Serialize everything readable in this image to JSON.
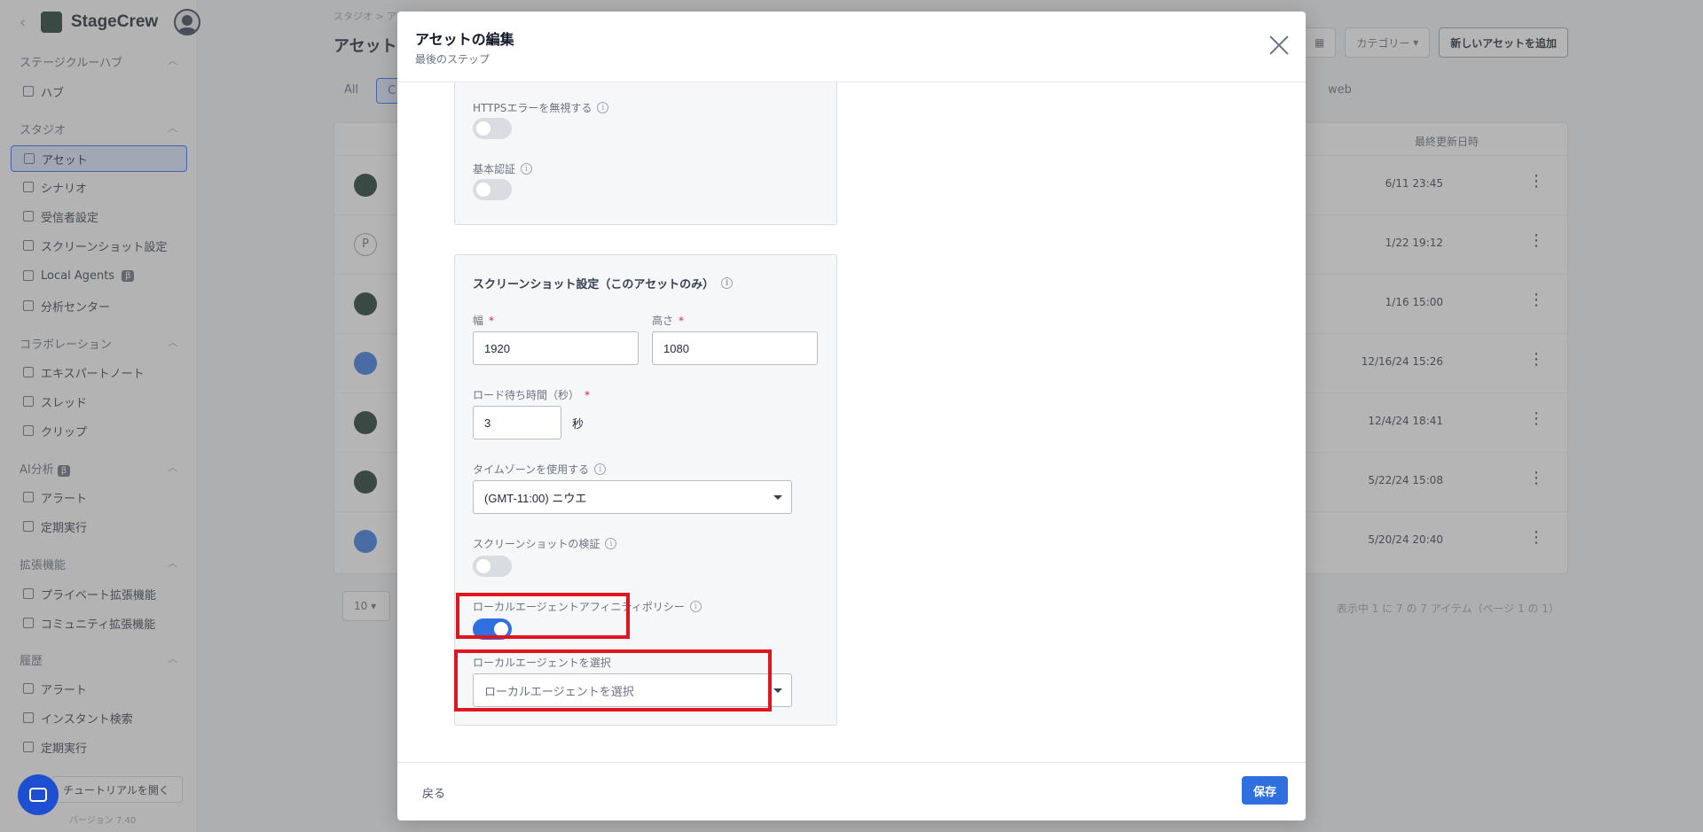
{
  "brand": {
    "name": "StageCrew"
  },
  "sidebar": {
    "sections": [
      {
        "label": "ステージクルーハブ"
      },
      {
        "label": "スタジオ"
      },
      {
        "label": "コラボレーション"
      },
      {
        "label": "AI分析",
        "badge": "β"
      },
      {
        "label": "拡張機能"
      },
      {
        "label": "履歴"
      }
    ],
    "items": [
      {
        "label": "ハブ"
      },
      {
        "label": "アセット"
      },
      {
        "label": "シナリオ"
      },
      {
        "label": "受信者設定"
      },
      {
        "label": "スクリーンショット設定"
      },
      {
        "label": "Local Agents",
        "badge": "β"
      },
      {
        "label": "分析センター"
      },
      {
        "label": "エキスパートノート"
      },
      {
        "label": "スレッド"
      },
      {
        "label": "クリップ"
      },
      {
        "label": "アラート"
      },
      {
        "label": "定期実行"
      },
      {
        "label": "プライベート拡張機能"
      },
      {
        "label": "コミュニティ拡張機能"
      },
      {
        "label": "アラート"
      },
      {
        "label": "インスタント検索"
      },
      {
        "label": "定期実行"
      }
    ],
    "tutorial_label": "チュートリアルを開く",
    "version": "バージョン 7.40"
  },
  "page": {
    "breadcrumb": "スタジオ > ア",
    "title": "アセット",
    "tabs": [
      "All",
      "C"
    ],
    "tab_web": "web",
    "toolbar": {
      "category": "カテゴリー",
      "add_asset": "新しいアセットを追加"
    },
    "table_header_date": "最終更新日時",
    "rows": [
      {
        "date": "6/11 23:45"
      },
      {
        "date": "1/22 19:12",
        "icon_letter": "P"
      },
      {
        "date": "1/16 15:00"
      },
      {
        "date": "12/16/24 15:26"
      },
      {
        "date": "12/4/24 18:41"
      },
      {
        "date": "5/22/24 15:08"
      },
      {
        "date": "5/20/24 20:40"
      }
    ],
    "page_size": "10",
    "pager_info": "表示中 1 に 7 の 7 アイテム（ページ 1 の 1）"
  },
  "modal": {
    "title": "アセットの編集",
    "subtitle": "最後のステップ",
    "ignore_https_label": "HTTPSエラーを無視する",
    "ignore_https_on": false,
    "basic_auth_label": "基本認証",
    "basic_auth_on": false,
    "screenshot": {
      "title": "スクリーンショット設定（このアセットのみ）",
      "width_label": "幅",
      "width_value": "1920",
      "height_label": "高さ",
      "height_value": "1080",
      "required_mark": "*",
      "load_wait_label": "ロード待ち時間（秒）",
      "load_wait_value": "3",
      "load_wait_unit": "秒",
      "timezone_label": "タイムゾーンを使用する",
      "timezone_value": "(GMT-11:00) ニウエ",
      "verify_label": "スクリーンショットの検証",
      "verify_on": false,
      "affinity_label": "ローカルエージェントアフィニティポリシー",
      "affinity_on": true,
      "agent_select_label": "ローカルエージェントを選択",
      "agent_select_placeholder": "ローカルエージェントを選択"
    },
    "back_label": "戻る",
    "save_label": "保存"
  },
  "colors": {
    "accent": "#2f6fe0",
    "highlight": "#e0151f",
    "brand": "#1f3b32"
  }
}
